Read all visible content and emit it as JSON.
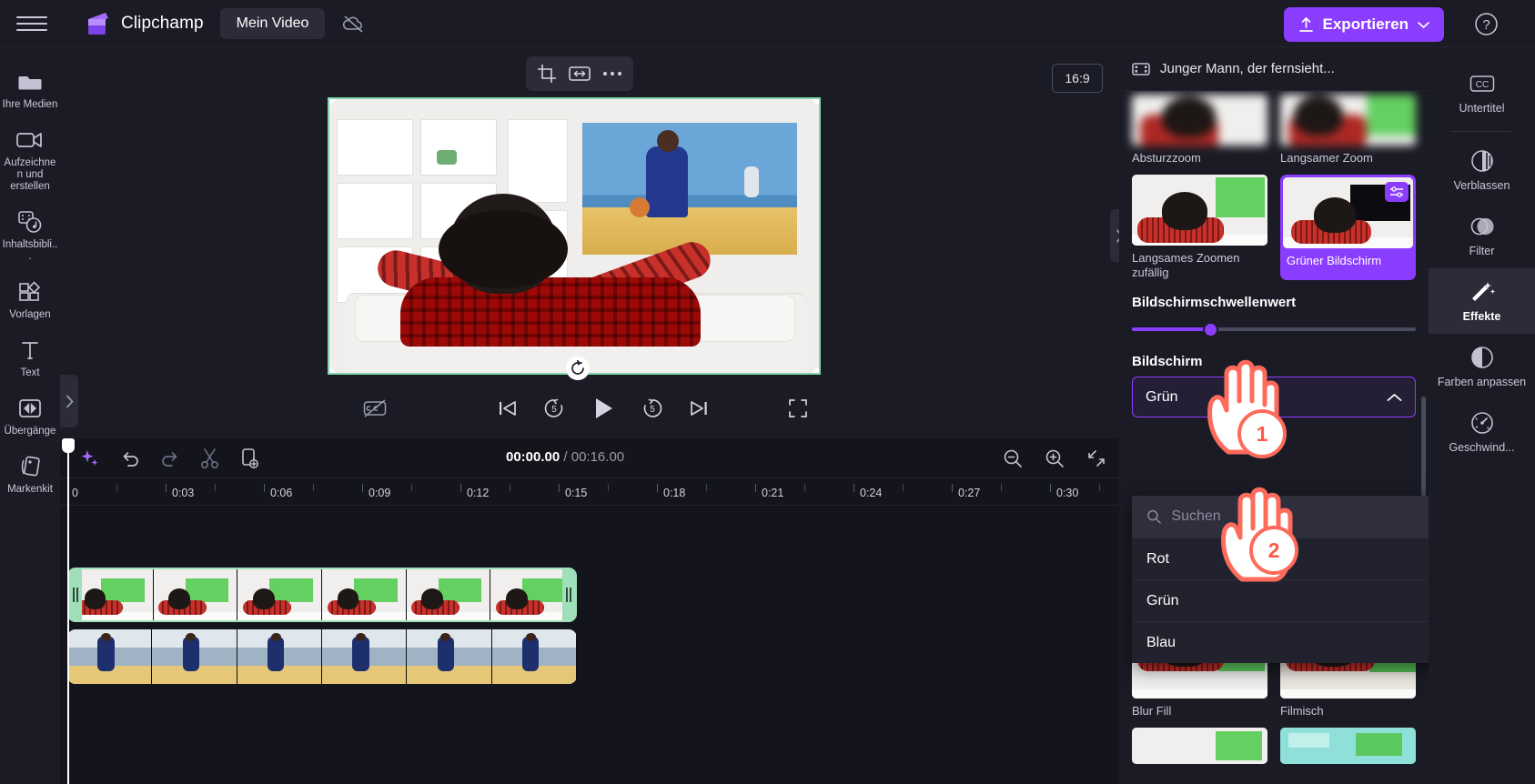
{
  "topbar": {
    "menu_icon": "hamburger-icon",
    "brand": "Clipchamp",
    "project_tab": "Mein Video",
    "cloud_icon": "cloud-off-icon",
    "export_label": "Exportieren",
    "export_icon": "upload-icon",
    "export_chevron": "chevron-down-icon",
    "help_icon": "help-circle-icon",
    "accent_color": "#8b3dff"
  },
  "left_rail": {
    "items": [
      {
        "label": "Ihre Medien",
        "icon": "folder-icon"
      },
      {
        "label": "Aufzeichnen und erstellen",
        "icon": "video-camera-icon"
      },
      {
        "label": "Inhaltsbibli...",
        "icon": "content-library-icon"
      },
      {
        "label": "Vorlagen",
        "icon": "templates-icon"
      },
      {
        "label": "Text",
        "icon": "text-icon"
      },
      {
        "label": "Übergänge",
        "icon": "transitions-icon"
      },
      {
        "label": "Markenkit",
        "icon": "brandkit-icon"
      }
    ]
  },
  "preview": {
    "toolbar": [
      {
        "name": "crop-button",
        "icon": "crop-icon"
      },
      {
        "name": "fit-button",
        "icon": "arrows-horizontal-icon"
      },
      {
        "name": "more-button",
        "icon": "more-dots-icon"
      }
    ],
    "aspect_ratio": "16:9",
    "rotate_icon": "rotate-icon",
    "selection_color": "#7fd8a8",
    "controls": [
      {
        "name": "captions-toggle",
        "icon": "captions-off-icon"
      },
      {
        "name": "skip-start-button",
        "icon": "skip-previous-icon"
      },
      {
        "name": "rewind-5-button",
        "icon": "rewind-5-icon"
      },
      {
        "name": "play-button",
        "icon": "play-icon"
      },
      {
        "name": "forward-5-button",
        "icon": "forward-5-icon"
      },
      {
        "name": "skip-end-button",
        "icon": "skip-next-icon"
      },
      {
        "name": "fullscreen-button",
        "icon": "fullscreen-icon"
      }
    ]
  },
  "timeline": {
    "toolbar": [
      {
        "name": "magic-button",
        "icon": "sparkle-icon"
      },
      {
        "name": "undo-button",
        "icon": "undo-icon"
      },
      {
        "name": "redo-button",
        "icon": "redo-icon"
      },
      {
        "name": "split-button",
        "icon": "scissors-icon"
      },
      {
        "name": "duplicate-button",
        "icon": "duplicate-icon"
      }
    ],
    "current_time": "00:00.00",
    "separator": "/",
    "total_time": "00:16.00",
    "right_tools": [
      {
        "name": "zoom-out-button",
        "icon": "zoom-out-icon"
      },
      {
        "name": "zoom-in-button",
        "icon": "zoom-in-icon"
      },
      {
        "name": "fit-timeline-button",
        "icon": "fit-arrows-icon"
      }
    ],
    "ruler_labels": [
      "0",
      "0:03",
      "0:06",
      "0:09",
      "0:12",
      "0:15",
      "0:18",
      "0:21",
      "0:24",
      "0:27",
      "0:30"
    ],
    "tracks": [
      {
        "name": "video-clip-1",
        "selected": true
      },
      {
        "name": "video-clip-2",
        "selected": false
      }
    ]
  },
  "right_panel": {
    "header_icon": "film-strip-icon",
    "header_title": "Junger Mann, der fernsieht...",
    "effects": [
      {
        "label": "Absturzzoom",
        "active": false
      },
      {
        "label": "Langsamer Zoom",
        "active": false
      },
      {
        "label": "Langsames Zoomen zufällig",
        "active": false
      },
      {
        "label": "Grüner Bildschirm",
        "active": true
      },
      {
        "label": "Blur Fill",
        "active": false
      },
      {
        "label": "Filmisch",
        "active": false
      }
    ],
    "threshold_title": "Bildschirmschwellenwert",
    "threshold_value": 28,
    "screen_color_label": "Bildschirm",
    "selected_color": "Grün",
    "chevron_icon": "chevron-up-icon",
    "search_placeholder": "Suchen",
    "search_icon": "search-icon",
    "color_options": [
      "Rot",
      "Grün",
      "Blau"
    ]
  },
  "far_rail": {
    "items": [
      {
        "label": "Untertitel",
        "icon": "closed-captions-icon",
        "active": false
      },
      {
        "label": "Verblassen",
        "icon": "fade-icon",
        "active": false
      },
      {
        "label": "Filter",
        "icon": "filter-icon",
        "active": false
      },
      {
        "label": "Effekte",
        "icon": "magic-wand-icon",
        "active": true
      },
      {
        "label": "Farben anpassen",
        "icon": "contrast-icon",
        "active": false
      },
      {
        "label": "Geschwind...",
        "icon": "speedometer-icon",
        "active": false
      }
    ]
  },
  "annotations": {
    "steps": [
      {
        "number": "1",
        "icon": "pointing-hand-icon"
      },
      {
        "number": "2",
        "icon": "pointing-hand-icon"
      }
    ],
    "highlight_color": "#ff6b5b"
  }
}
